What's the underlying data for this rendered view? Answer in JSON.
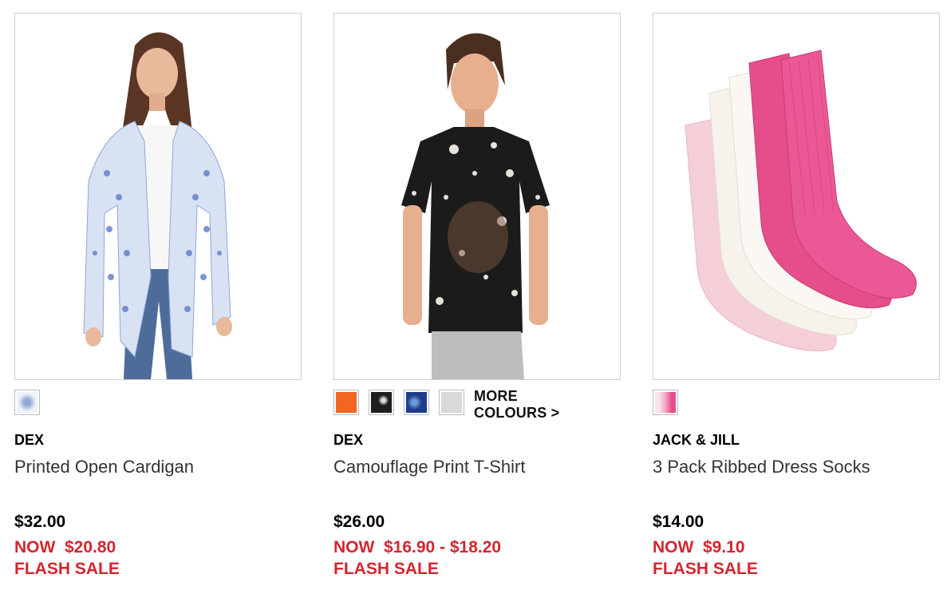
{
  "products": [
    {
      "brand": "DEX",
      "name": "Printed Open Cardigan",
      "price": "$32.00",
      "now_price": "NOW  $20.80",
      "sale_label": "FLASH SALE",
      "swatches": [
        "#dfe7f4"
      ]
    },
    {
      "brand": "DEX",
      "name": "Camouflage Print T-Shirt",
      "price": "$26.00",
      "now_price": "NOW  $16.90 - $18.20",
      "sale_label": "FLASH SALE",
      "swatches": [
        "#f26522",
        "#1e1e1e",
        "#1f3c88",
        "#d9d9d9"
      ],
      "more_colours": "MORE COLOURS >"
    },
    {
      "brand": "JACK & JILL",
      "name": "3 Pack Ribbed Dress Socks",
      "price": "$14.00",
      "now_price": "NOW  $9.10",
      "sale_label": "FLASH SALE",
      "swatches": [
        "#f2a7c3"
      ]
    }
  ],
  "colors": {
    "sale_red": "#d22630",
    "border": "#cfcfcf"
  }
}
